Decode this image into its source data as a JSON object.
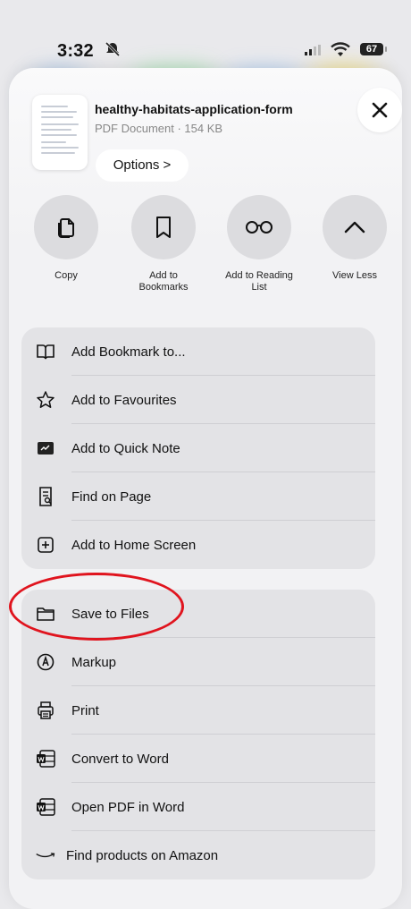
{
  "status_bar": {
    "time": "3:32",
    "battery": "67"
  },
  "document": {
    "title": "healthy-habitats-application-form",
    "subtitle": "PDF Document · 154 KB"
  },
  "options_label": "Options >",
  "actions": [
    {
      "label": "Copy",
      "icon": "copy-icon"
    },
    {
      "label": "Add to\nBookmarks",
      "icon": "bookmark-icon"
    },
    {
      "label": "Add to Reading\nList",
      "icon": "reading-glasses-icon"
    },
    {
      "label": "View Less",
      "icon": "chevron-up-icon"
    }
  ],
  "menu_group_1": [
    {
      "label": "Add Bookmark to...",
      "icon": "book-icon"
    },
    {
      "label": "Add to Favourites",
      "icon": "star-icon"
    },
    {
      "label": "Add to Quick Note",
      "icon": "quick-note-icon"
    },
    {
      "label": "Find on Page",
      "icon": "find-on-page-icon"
    },
    {
      "label": "Add to Home Screen",
      "icon": "plus-square-icon"
    }
  ],
  "menu_group_2": [
    {
      "label": "Save to Files",
      "icon": "folder-icon"
    },
    {
      "label": "Markup",
      "icon": "markup-icon"
    },
    {
      "label": "Print",
      "icon": "printer-icon"
    },
    {
      "label": "Convert to Word",
      "icon": "word-icon"
    },
    {
      "label": "Open PDF in Word",
      "icon": "word-icon"
    },
    {
      "label": "Find products on Amazon",
      "icon": "amazon-icon"
    }
  ],
  "colors": {
    "highlight": "#e0141e",
    "sheet": "#f2f2f4",
    "group": "#e3e3e6"
  }
}
